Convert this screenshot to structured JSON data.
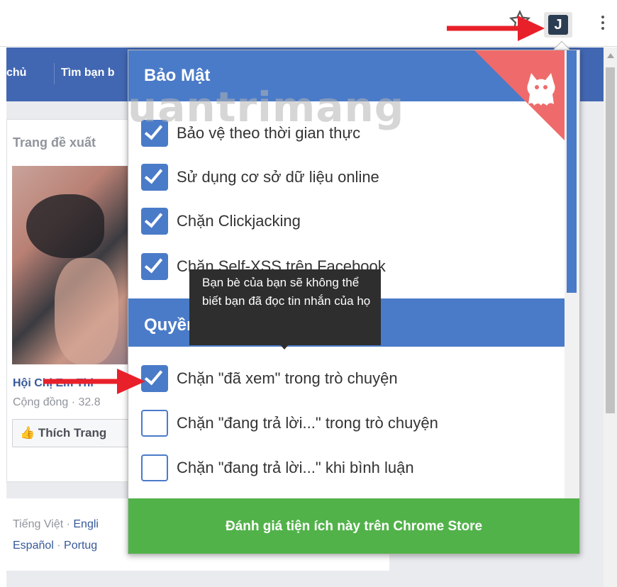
{
  "fb": {
    "nav": {
      "home": "chủ",
      "find_friends": "Tìm bạn b"
    },
    "suggested_title": "Trang đề xuất",
    "page_name": "Hội Chị Em Thi",
    "page_meta": "Cộng đồng · 32.8",
    "like_button": "Thích Trang",
    "lang_line1": {
      "current": "Tiếng Việt",
      "sep": " · ",
      "english": "Engli"
    },
    "lang_line2": {
      "spanish": "Español",
      "sep": " · ",
      "portuguese": "Portug"
    }
  },
  "extension": {
    "section_security": "Bảo Mật",
    "security_options": [
      {
        "label": "Bảo vệ theo thời gian thực",
        "checked": true
      },
      {
        "label": "Sử dụng cơ sở dữ liệu online",
        "checked": true
      },
      {
        "label": "Chặn Clickjacking",
        "checked": true
      },
      {
        "label": "Chặn Self-XSS trên Facebook",
        "checked": true
      }
    ],
    "section_privacy": "Quyền riêng tư (Facebook)",
    "privacy_options": [
      {
        "label": "Chặn \"đã xem\" trong trò chuyện",
        "checked": true
      },
      {
        "label": "Chặn \"đang trả lời...\" trong trò chuyện",
        "checked": false
      },
      {
        "label": "Chặn \"đang trả lời...\" khi bình luận",
        "checked": false
      }
    ],
    "tooltip": "Bạn bè của bạn sẽ không thể biết bạn đã đọc tin nhắn của họ",
    "rate_button": "Đánh giá tiện ích này trên Chrome Store"
  },
  "watermark": "uantrimang",
  "colors": {
    "accent": "#4a7bc8",
    "corner": "#ef6b6b",
    "rate": "#52b24a",
    "fb_blue": "#4267b2",
    "arrow": "#e8202a"
  }
}
